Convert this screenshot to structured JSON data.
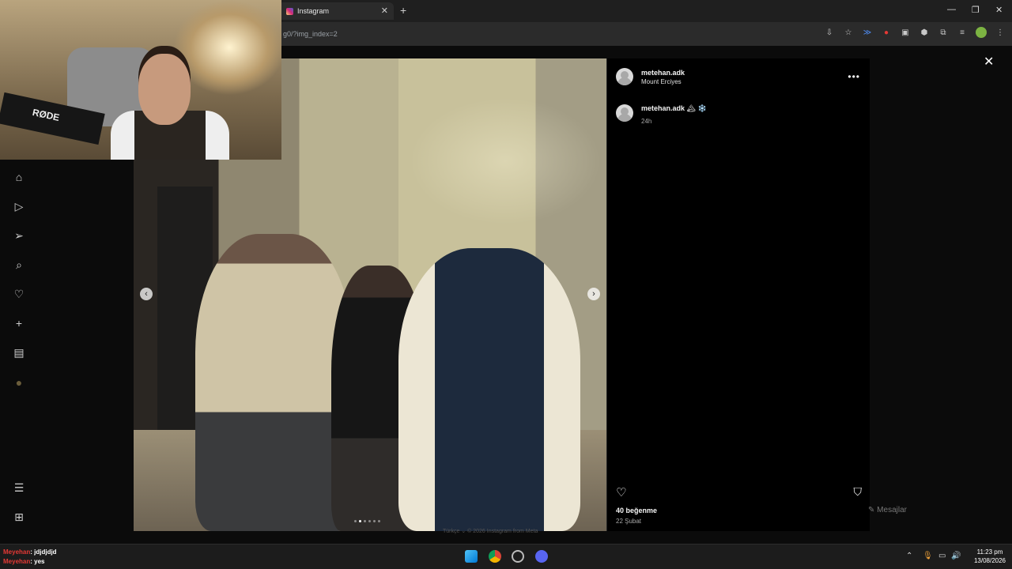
{
  "browser": {
    "tab_title": "Instagram",
    "tab_close": "✕",
    "new_tab": "+",
    "url_fragment": "g0/?img_index=2",
    "window_controls": [
      "—",
      "❐",
      "✕"
    ]
  },
  "page": {
    "close": "✕",
    "prev_arrow": "‹",
    "next_arrow": "›",
    "carousel": {
      "count": 6,
      "active_index": 1
    }
  },
  "post": {
    "username": "metehan.adk",
    "location": "Mount Erciyes",
    "more": "•••",
    "caption": {
      "username": "metehan.adk",
      "text": "🏔 ❄️",
      "time": "24h"
    },
    "likes": "40 beğenme",
    "date": "22 Şubat"
  },
  "background": {
    "messages": "Mesajlar",
    "footer": "Türkçe ⌄   © 2026 Instagram from Meta"
  },
  "webcam": {
    "mic_brand": "RØDE"
  },
  "chat": [
    {
      "name": "Meyehan",
      "text": ": jdjdjdjd"
    },
    {
      "name": "Meyehan",
      "text": ": yes"
    }
  ],
  "clock": {
    "time": "11:23 pm",
    "date": "13/08/2026"
  },
  "sidebar_icons": [
    "home-icon",
    "reels-icon",
    "direct-icon",
    "search-icon",
    "notifications-icon",
    "create-icon",
    "dashboard-icon",
    "profile-icon",
    "menu-icon",
    "more-icon"
  ]
}
